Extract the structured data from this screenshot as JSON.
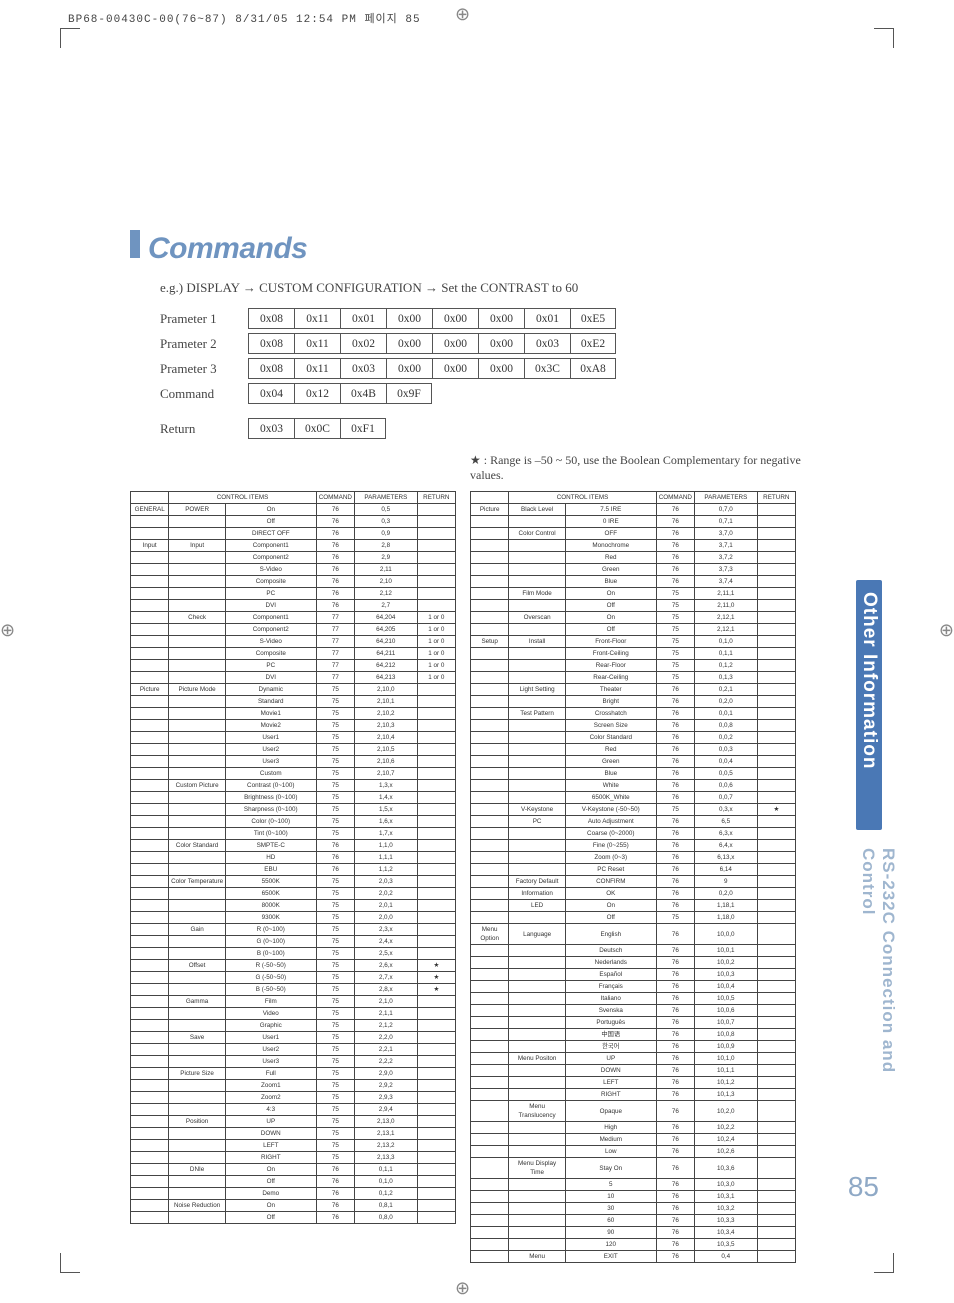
{
  "meta": {
    "header": "BP68-00430C-00(76~87)  8/31/05  12:54 PM  페이지 85",
    "page_number": "85"
  },
  "side": {
    "tab1": "Other Information",
    "tab2": "RS-232C Connection and Control"
  },
  "heading": "Commands",
  "example_line": "e.g.) DISPLAY → CUSTOM CONFIGURATION → Set the CONTRAST to 60",
  "note_line": "★ : Range is –50 ~ 50, use the Boolean Complementary for negative values.",
  "params": [
    {
      "label": "Prameter 1",
      "bytes": [
        "0x08",
        "0x11",
        "0x01",
        "0x00",
        "0x00",
        "0x00",
        "0x01",
        "0xE5"
      ]
    },
    {
      "label": "Prameter 2",
      "bytes": [
        "0x08",
        "0x11",
        "0x02",
        "0x00",
        "0x00",
        "0x00",
        "0x03",
        "0xE2"
      ]
    },
    {
      "label": "Prameter 3",
      "bytes": [
        "0x08",
        "0x11",
        "0x03",
        "0x00",
        "0x00",
        "0x00",
        "0x3C",
        "0xA8"
      ]
    },
    {
      "label": "Command",
      "bytes": [
        "0x04",
        "0x12",
        "0x4B",
        "0x9F"
      ]
    },
    {
      "label": "Return",
      "bytes": [
        "0x03",
        "0x0C",
        "0xF1"
      ]
    }
  ],
  "table_headers": {
    "control_items": "CONTROL ITEMS",
    "command": "COMMAND",
    "parameters": "PARAMETERS",
    "return": "RETURN"
  },
  "chart_data": {
    "type": "table",
    "columns": [
      "group",
      "category",
      "item",
      "command",
      "parameters",
      "return"
    ],
    "left": [
      [
        "GENERAL",
        "POWER",
        "On",
        "76",
        "0,5",
        ""
      ],
      [
        "",
        "",
        "Off",
        "76",
        "0,3",
        ""
      ],
      [
        "",
        "",
        "DIRECT OFF",
        "76",
        "0,9",
        ""
      ],
      [
        "Input",
        "Input",
        "Component1",
        "76",
        "2,8",
        ""
      ],
      [
        "",
        "",
        "Component2",
        "76",
        "2,9",
        ""
      ],
      [
        "",
        "",
        "S-Video",
        "76",
        "2,11",
        ""
      ],
      [
        "",
        "",
        "Composite",
        "76",
        "2,10",
        ""
      ],
      [
        "",
        "",
        "PC",
        "76",
        "2,12",
        ""
      ],
      [
        "",
        "",
        "DVI",
        "76",
        "2,7",
        ""
      ],
      [
        "",
        "Check",
        "Component1",
        "77",
        "64,204",
        "1 or 0"
      ],
      [
        "",
        "",
        "Component2",
        "77",
        "64,205",
        "1 or 0"
      ],
      [
        "",
        "",
        "S-Video",
        "77",
        "64,210",
        "1 or 0"
      ],
      [
        "",
        "",
        "Composite",
        "77",
        "64,211",
        "1 or 0"
      ],
      [
        "",
        "",
        "PC",
        "77",
        "64,212",
        "1 or 0"
      ],
      [
        "",
        "",
        "DVI",
        "77",
        "64,213",
        "1 or 0"
      ],
      [
        "Picture",
        "Picture Mode",
        "Dynamic",
        "75",
        "2,10,0",
        ""
      ],
      [
        "",
        "",
        "Standard",
        "75",
        "2,10,1",
        ""
      ],
      [
        "",
        "",
        "Movie1",
        "75",
        "2,10,2",
        ""
      ],
      [
        "",
        "",
        "Movie2",
        "75",
        "2,10,3",
        ""
      ],
      [
        "",
        "",
        "User1",
        "75",
        "2,10,4",
        ""
      ],
      [
        "",
        "",
        "User2",
        "75",
        "2,10,5",
        ""
      ],
      [
        "",
        "",
        "User3",
        "75",
        "2,10,6",
        ""
      ],
      [
        "",
        "",
        "Custom",
        "75",
        "2,10,7",
        ""
      ],
      [
        "",
        "Custom Picture",
        "Contrast (0~100)",
        "75",
        "1,3,x",
        ""
      ],
      [
        "",
        "",
        "Brightness (0~100)",
        "75",
        "1,4,x",
        ""
      ],
      [
        "",
        "",
        "Sharpness (0~100)",
        "75",
        "1,5,x",
        ""
      ],
      [
        "",
        "",
        "Color (0~100)",
        "75",
        "1,6,x",
        ""
      ],
      [
        "",
        "",
        "Tint (0~100)",
        "75",
        "1,7,x",
        ""
      ],
      [
        "",
        "Color Standard",
        "SMPTE-C",
        "76",
        "1,1,0",
        ""
      ],
      [
        "",
        "",
        "HD",
        "76",
        "1,1,1",
        ""
      ],
      [
        "",
        "",
        "EBU",
        "76",
        "1,1,2",
        ""
      ],
      [
        "",
        "Color Temperature",
        "5500K",
        "75",
        "2,0,3",
        ""
      ],
      [
        "",
        "",
        "6500K",
        "75",
        "2,0,2",
        ""
      ],
      [
        "",
        "",
        "8000K",
        "75",
        "2,0,1",
        ""
      ],
      [
        "",
        "",
        "9300K",
        "75",
        "2,0,0",
        ""
      ],
      [
        "",
        "Gain",
        "R (0~100)",
        "75",
        "2,3,x",
        ""
      ],
      [
        "",
        "",
        "G (0~100)",
        "75",
        "2,4,x",
        ""
      ],
      [
        "",
        "",
        "B (0~100)",
        "75",
        "2,5,x",
        ""
      ],
      [
        "",
        "Offset",
        "R (-50~50)",
        "75",
        "2,6,x",
        "★"
      ],
      [
        "",
        "",
        "G (-50~50)",
        "75",
        "2,7,x",
        "★"
      ],
      [
        "",
        "",
        "B (-50~50)",
        "75",
        "2,8,x",
        "★"
      ],
      [
        "",
        "Gamma",
        "Film",
        "75",
        "2,1,0",
        ""
      ],
      [
        "",
        "",
        "Video",
        "75",
        "2,1,1",
        ""
      ],
      [
        "",
        "",
        "Graphic",
        "75",
        "2,1,2",
        ""
      ],
      [
        "",
        "Save",
        "User1",
        "75",
        "2,2,0",
        ""
      ],
      [
        "",
        "",
        "User2",
        "75",
        "2,2,1",
        ""
      ],
      [
        "",
        "",
        "User3",
        "75",
        "2,2,2",
        ""
      ],
      [
        "",
        "Picture Size",
        "Full",
        "75",
        "2,9,0",
        ""
      ],
      [
        "",
        "",
        "Zoom1",
        "75",
        "2,9,2",
        ""
      ],
      [
        "",
        "",
        "Zoom2",
        "75",
        "2,9,3",
        ""
      ],
      [
        "",
        "",
        "4:3",
        "75",
        "2,9,4",
        ""
      ],
      [
        "",
        "Position",
        "UP",
        "75",
        "2,13,0",
        ""
      ],
      [
        "",
        "",
        "DOWN",
        "75",
        "2,13,1",
        ""
      ],
      [
        "",
        "",
        "LEFT",
        "75",
        "2,13,2",
        ""
      ],
      [
        "",
        "",
        "RIGHT",
        "75",
        "2,13,3",
        ""
      ],
      [
        "",
        "DNIe",
        "On",
        "76",
        "0,1,1",
        ""
      ],
      [
        "",
        "",
        "Off",
        "76",
        "0,1,0",
        ""
      ],
      [
        "",
        "",
        "Demo",
        "76",
        "0,1,2",
        ""
      ],
      [
        "",
        "Noise Reduction",
        "On",
        "76",
        "0,8,1",
        ""
      ],
      [
        "",
        "",
        "Off",
        "76",
        "0,8,0",
        ""
      ]
    ],
    "right": [
      [
        "Picture",
        "Black Level",
        "7.5 IRE",
        "76",
        "0,7,0",
        ""
      ],
      [
        "",
        "",
        "0 IRE",
        "76",
        "0,7,1",
        ""
      ],
      [
        "",
        "Color Control",
        "OFF",
        "76",
        "3,7,0",
        ""
      ],
      [
        "",
        "",
        "Monochrome",
        "76",
        "3,7,1",
        ""
      ],
      [
        "",
        "",
        "Red",
        "76",
        "3,7,2",
        ""
      ],
      [
        "",
        "",
        "Green",
        "76",
        "3,7,3",
        ""
      ],
      [
        "",
        "",
        "Blue",
        "76",
        "3,7,4",
        ""
      ],
      [
        "",
        "Film Mode",
        "On",
        "75",
        "2,11,1",
        ""
      ],
      [
        "",
        "",
        "Off",
        "75",
        "2,11,0",
        ""
      ],
      [
        "",
        "Overscan",
        "On",
        "75",
        "2,12,1",
        ""
      ],
      [
        "",
        "",
        "Off",
        "75",
        "2,12,1",
        ""
      ],
      [
        "Setup",
        "Install",
        "Front-Floor",
        "75",
        "0,1,0",
        ""
      ],
      [
        "",
        "",
        "Front-Ceiling",
        "75",
        "0,1,1",
        ""
      ],
      [
        "",
        "",
        "Rear-Floor",
        "75",
        "0,1,2",
        ""
      ],
      [
        "",
        "",
        "Rear-Ceiling",
        "75",
        "0,1,3",
        ""
      ],
      [
        "",
        "Light Setting",
        "Theater",
        "76",
        "0,2,1",
        ""
      ],
      [
        "",
        "",
        "Bright",
        "76",
        "0,2,0",
        ""
      ],
      [
        "",
        "Test Pattern",
        "Crosshatch",
        "76",
        "0,0,1",
        ""
      ],
      [
        "",
        "",
        "Screen Size",
        "76",
        "0,0,8",
        ""
      ],
      [
        "",
        "",
        "Color Standard",
        "76",
        "0,0,2",
        ""
      ],
      [
        "",
        "",
        "Red",
        "76",
        "0,0,3",
        ""
      ],
      [
        "",
        "",
        "Green",
        "76",
        "0,0,4",
        ""
      ],
      [
        "",
        "",
        "Blue",
        "76",
        "0,0,5",
        ""
      ],
      [
        "",
        "",
        "White",
        "76",
        "0,0,6",
        ""
      ],
      [
        "",
        "",
        "6500K_White",
        "76",
        "0,0,7",
        ""
      ],
      [
        "",
        "V-Keystone",
        "V-Keystone (-50~50)",
        "75",
        "0,3,x",
        "★"
      ],
      [
        "",
        "PC",
        "Auto Adjustment",
        "76",
        "6,5",
        ""
      ],
      [
        "",
        "",
        "Coarse (0~2000)",
        "76",
        "6,3,x",
        ""
      ],
      [
        "",
        "",
        "Fine (0~255)",
        "76",
        "6,4,x",
        ""
      ],
      [
        "",
        "",
        "Zoom (0~3)",
        "76",
        "6,13,x",
        ""
      ],
      [
        "",
        "",
        "PC Reset",
        "76",
        "6,14",
        ""
      ],
      [
        "",
        "Factory Default",
        "CONFIRM",
        "76",
        "9",
        ""
      ],
      [
        "",
        "Information",
        "OK",
        "76",
        "0,2,0",
        ""
      ],
      [
        "",
        "LED",
        "On",
        "76",
        "1,18,1",
        ""
      ],
      [
        "",
        "",
        "Off",
        "75",
        "1,18,0",
        ""
      ],
      [
        "Menu Option",
        "Language",
        "English",
        "76",
        "10,0,0",
        ""
      ],
      [
        "",
        "",
        "Deutsch",
        "76",
        "10,0,1",
        ""
      ],
      [
        "",
        "",
        "Nederlands",
        "76",
        "10,0,2",
        ""
      ],
      [
        "",
        "",
        "Español",
        "76",
        "10,0,3",
        ""
      ],
      [
        "",
        "",
        "Français",
        "76",
        "10,0,4",
        ""
      ],
      [
        "",
        "",
        "Italiano",
        "76",
        "10,0,5",
        ""
      ],
      [
        "",
        "",
        "Svenska",
        "76",
        "10,0,6",
        ""
      ],
      [
        "",
        "",
        "Português",
        "76",
        "10,0,7",
        ""
      ],
      [
        "",
        "",
        "中国语",
        "76",
        "10,0,8",
        ""
      ],
      [
        "",
        "",
        "한국어",
        "76",
        "10,0,9",
        ""
      ],
      [
        "",
        "Menu Positon",
        "UP",
        "76",
        "10,1,0",
        ""
      ],
      [
        "",
        "",
        "DOWN",
        "76",
        "10,1,1",
        ""
      ],
      [
        "",
        "",
        "LEFT",
        "76",
        "10,1,2",
        ""
      ],
      [
        "",
        "",
        "RIGHT",
        "76",
        "10,1,3",
        ""
      ],
      [
        "",
        "Menu Translucency",
        "Opaque",
        "76",
        "10,2,0",
        ""
      ],
      [
        "",
        "",
        "High",
        "76",
        "10,2,2",
        ""
      ],
      [
        "",
        "",
        "Medium",
        "76",
        "10,2,4",
        ""
      ],
      [
        "",
        "",
        "Low",
        "76",
        "10,2,6",
        ""
      ],
      [
        "",
        "Menu Display Time",
        "Stay On",
        "76",
        "10,3,6",
        ""
      ],
      [
        "",
        "",
        "5",
        "76",
        "10,3,0",
        ""
      ],
      [
        "",
        "",
        "10",
        "76",
        "10,3,1",
        ""
      ],
      [
        "",
        "",
        "30",
        "76",
        "10,3,2",
        ""
      ],
      [
        "",
        "",
        "60",
        "76",
        "10,3,3",
        ""
      ],
      [
        "",
        "",
        "90",
        "76",
        "10,3,4",
        ""
      ],
      [
        "",
        "",
        "120",
        "76",
        "10,3,5",
        ""
      ],
      [
        "",
        "Menu",
        "EXIT",
        "76",
        "0,4",
        ""
      ]
    ]
  }
}
